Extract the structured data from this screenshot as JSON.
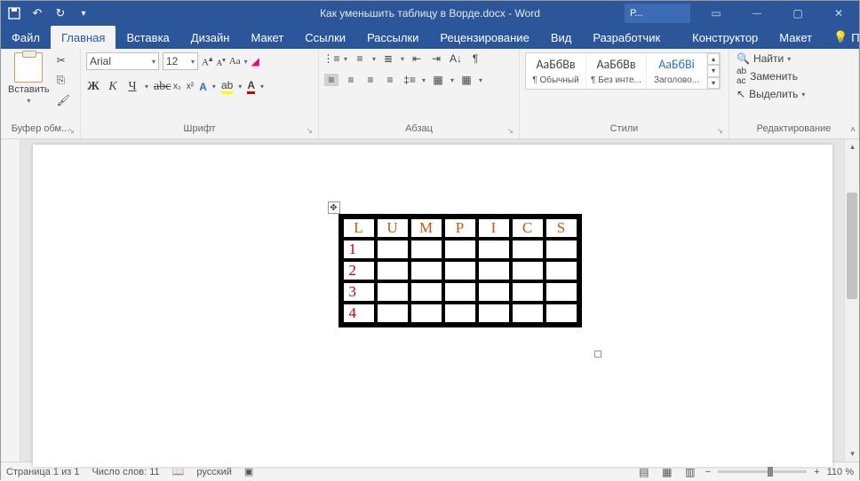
{
  "titlebar": {
    "title": "Как уменьшить таблицу в Ворде.docx - Word",
    "pbox": "Р..."
  },
  "tabs": {
    "file": "Файл",
    "home": "Главная",
    "insert": "Вставка",
    "design": "Дизайн",
    "layout": "Макет",
    "references": "Ссылки",
    "mailings": "Рассылки",
    "review": "Рецензирование",
    "view": "Вид",
    "developer": "Разработчик",
    "tt_design": "Конструктор",
    "tt_layout": "Макет",
    "tell": "Помощн"
  },
  "ribbon": {
    "clipboard": {
      "paste": "Вставить",
      "label": "Буфер обм..."
    },
    "font": {
      "name": "Arial",
      "size": "12",
      "label": "Шрифт",
      "bold": "Ж",
      "italic": "К",
      "underline": "Ч",
      "strike": "abc",
      "sub": "x₂",
      "sup": "x²",
      "grow": "A",
      "shrink": "A",
      "case": "Aa",
      "clear_icon": "clear"
    },
    "paragraph": {
      "label": "Абзац"
    },
    "styles": {
      "label": "Стили",
      "items": [
        {
          "sample": "АаБбВв",
          "name": "¶ Обычный"
        },
        {
          "sample": "АаБбВв",
          "name": "¶ Без инте..."
        },
        {
          "sample": "АаБбВі",
          "name": "Заголово...",
          "blue": true
        }
      ]
    },
    "editing": {
      "find": "Найти",
      "replace": "Заменить",
      "select": "Выделить",
      "label": "Редактирование"
    }
  },
  "doc_table": {
    "header": [
      "L",
      "U",
      "M",
      "P",
      "I",
      "C",
      "S"
    ],
    "rows": [
      "1",
      "2",
      "3",
      "4"
    ]
  },
  "status": {
    "page": "Страница 1 из 1",
    "words": "Число слов: 11",
    "lang": "русский",
    "zoom": "110 %"
  }
}
